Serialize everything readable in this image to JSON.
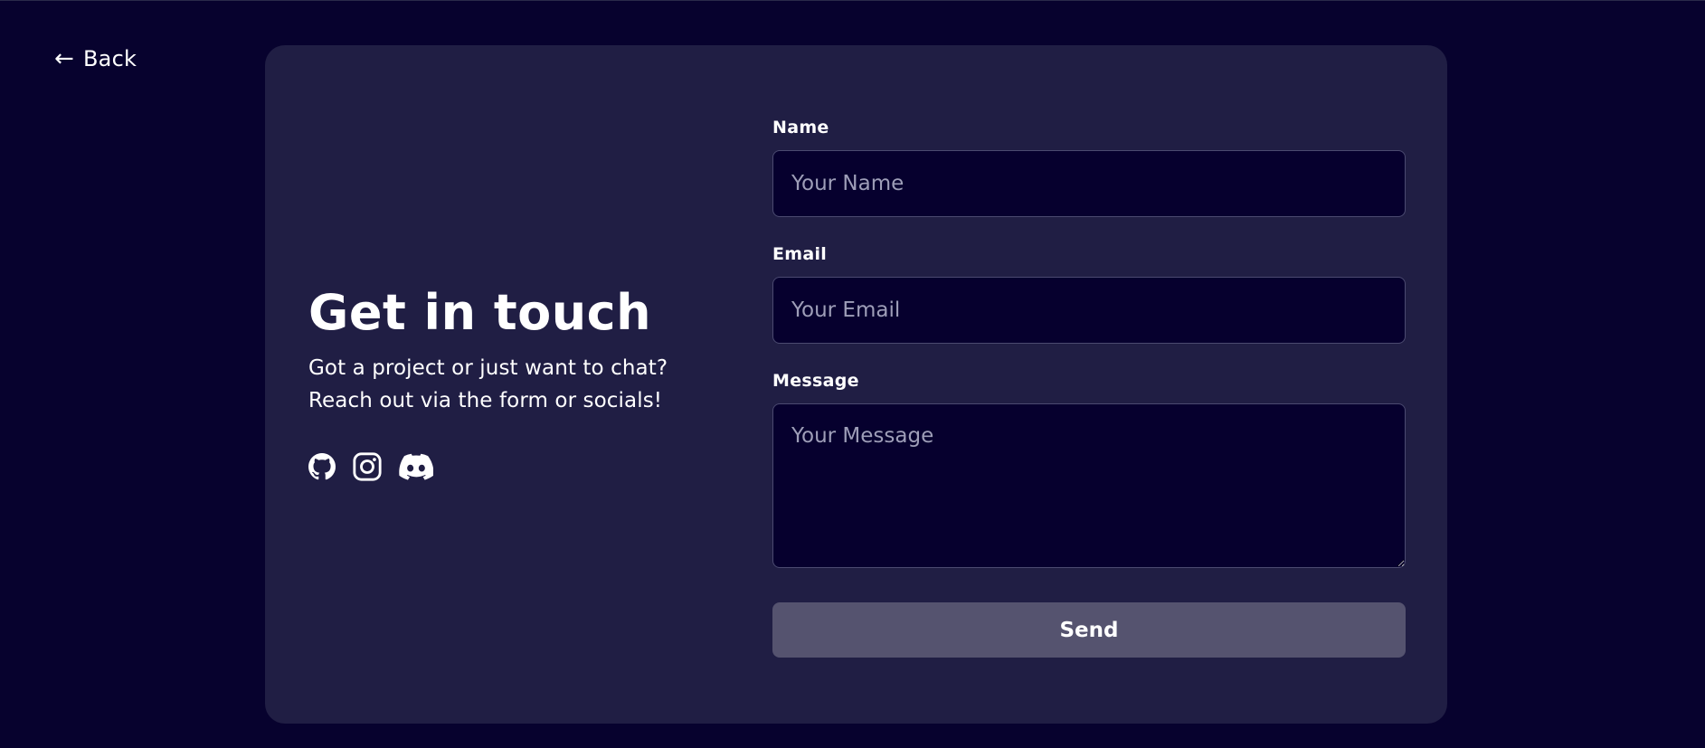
{
  "nav": {
    "back_label": "Back",
    "back_icon": "left-arrow-icon"
  },
  "intro": {
    "title": "Get in touch",
    "subtitle_line1": "Got a project or just want to chat?",
    "subtitle_line2": "Reach out via the form or socials!"
  },
  "socials": [
    {
      "name": "github",
      "icon": "github-icon"
    },
    {
      "name": "instagram",
      "icon": "instagram-icon"
    },
    {
      "name": "discord",
      "icon": "discord-icon"
    }
  ],
  "form": {
    "name": {
      "label": "Name",
      "placeholder": "Your Name",
      "value": ""
    },
    "email": {
      "label": "Email",
      "placeholder": "Your Email",
      "value": ""
    },
    "message": {
      "label": "Message",
      "placeholder": "Your Message",
      "value": ""
    },
    "submit_label": "Send"
  },
  "colors": {
    "page_background": "#07022e",
    "card_background": "#201e44",
    "input_background": "#06002e",
    "input_border": "#4b4a70",
    "button_background": "#55536f",
    "text": "#ffffff",
    "placeholder": "#9e9eb8"
  }
}
